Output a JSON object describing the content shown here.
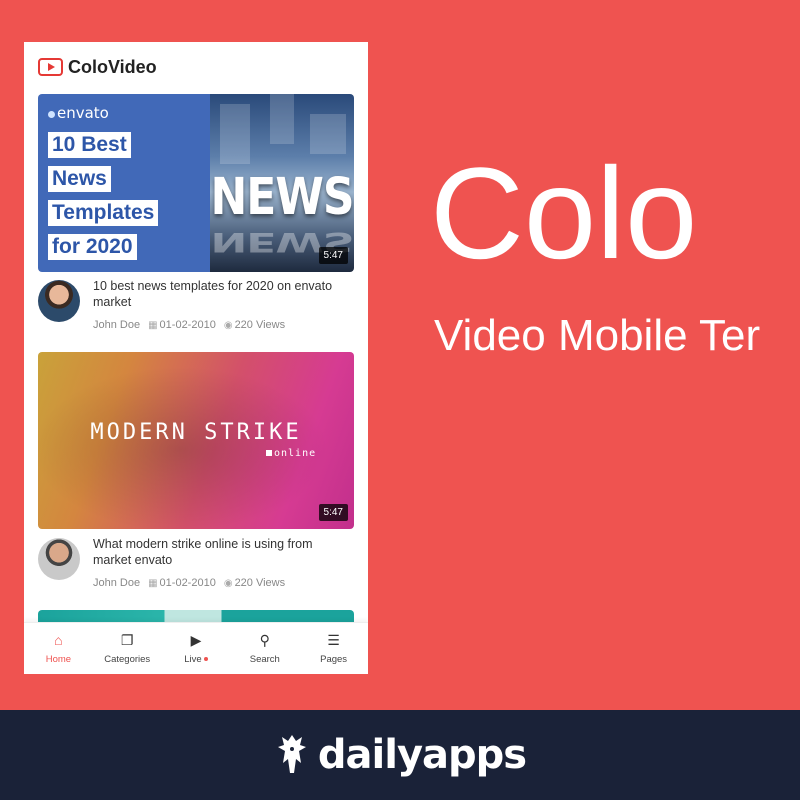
{
  "app": {
    "title": "ColoVideo"
  },
  "videos": [
    {
      "thumb": {
        "brand": "envato",
        "headline_lines": [
          "10 Best",
          "News",
          "Templates",
          "for 2020"
        ],
        "overlay_word": "NEWS"
      },
      "duration": "5:47",
      "title": "10 best news templates for 2020 on envato market",
      "author": "John Doe",
      "date": "01-02-2010",
      "views": "220 Views"
    },
    {
      "thumb": {
        "overlay_title": "MODERN STRIKE",
        "overlay_sub": "online"
      },
      "duration": "5:47",
      "title": "What modern strike online is using from market envato",
      "author": "John Doe",
      "date": "01-02-2010",
      "views": "220 Views"
    }
  ],
  "tabbar": [
    {
      "label": "Home",
      "icon": "home-icon",
      "active": true
    },
    {
      "label": "Categories",
      "icon": "categories-icon",
      "active": false
    },
    {
      "label": "Live",
      "icon": "play-icon",
      "active": false
    },
    {
      "label": "Search",
      "icon": "search-icon",
      "active": false
    },
    {
      "label": "Pages",
      "icon": "menu-icon",
      "active": false
    }
  ],
  "promo": {
    "title": "Colo",
    "subtitle": "Video Mobile Ter"
  },
  "footer": {
    "brand": "dailyapps"
  },
  "colors": {
    "background": "#ef5350",
    "accent": "#e53935",
    "footer": "#1a2238"
  }
}
